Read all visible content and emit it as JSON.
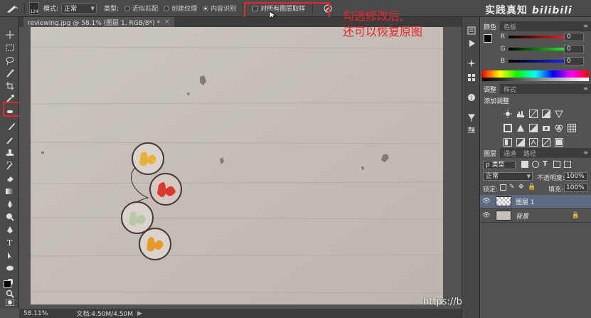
{
  "options_bar": {
    "brush_size": "124",
    "mode_label": "模式:",
    "mode_value": "正常",
    "type_label": "类型:",
    "type_options": [
      "近似匹配",
      "创建纹理",
      "内容识别"
    ],
    "sample_all_layers": "对所有图层取样"
  },
  "document": {
    "tab_title": "reviewing.jpg @ 58.1% (图层 1, RGB/8*) *",
    "close": "×"
  },
  "annotation": {
    "line1": "勾选修改后,",
    "line2": "还可以恢复原图"
  },
  "watermark": {
    "top": "实践真知",
    "bilibili": "bilibili",
    "url": "https://blog.csdn.net/chenhangx"
  },
  "status": {
    "zoom": "58.11%",
    "doc_size": "文档:4.50M/4.50M"
  },
  "color_panel": {
    "tabs": [
      "颜色",
      "色板"
    ],
    "channels": [
      {
        "name": "R",
        "value": "0",
        "track": "#ff2020"
      },
      {
        "name": "G",
        "value": "0",
        "track": "#20ff20"
      },
      {
        "name": "B",
        "value": "0",
        "track": "#2020ff"
      }
    ]
  },
  "adjust_panel": {
    "tabs": [
      "调整",
      "样式"
    ],
    "title": "添加调整"
  },
  "layers_panel": {
    "tabs": [
      "图层",
      "通道",
      "路径"
    ],
    "filter_label": "ρ 类型",
    "blend_mode": "正常",
    "opacity_label": "不透明度:",
    "opacity_value": "100%",
    "lock_label": "锁定:",
    "fill_label": "填充:",
    "fill_value": "100%",
    "layers": [
      {
        "name": "图层 1",
        "selected": true
      },
      {
        "name": "背景",
        "selected": false
      }
    ]
  }
}
